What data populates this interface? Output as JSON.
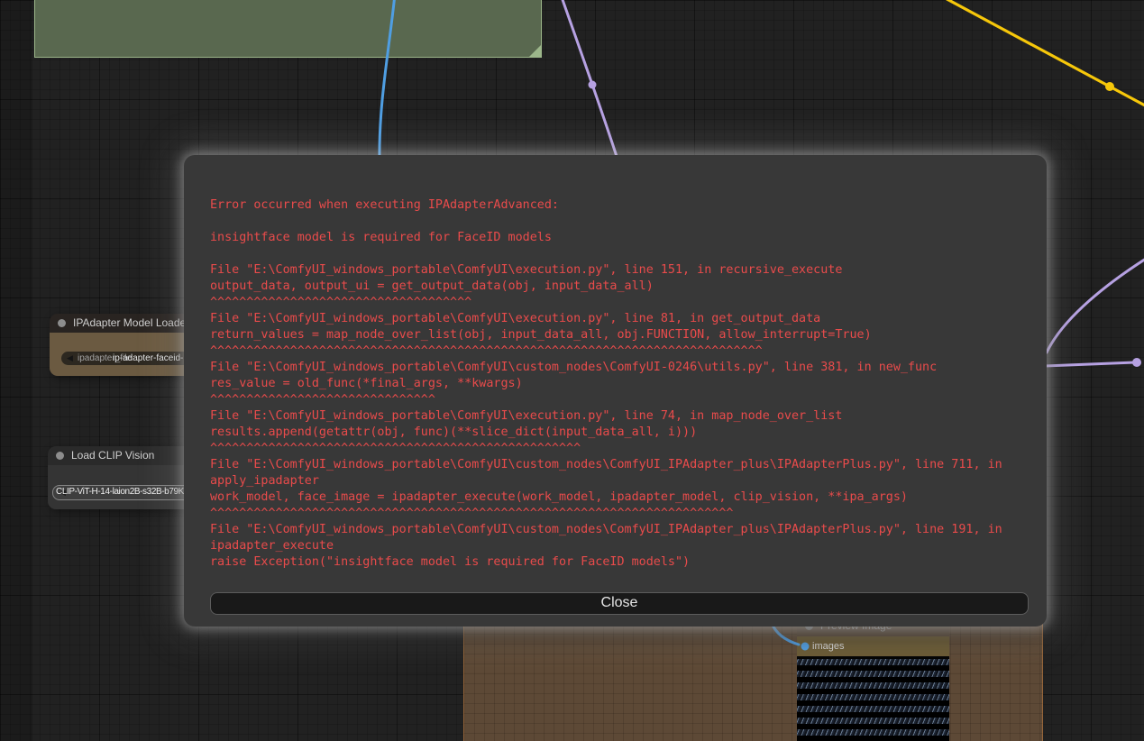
{
  "colors": {
    "link_blue": "#4f9ee2",
    "link_purple": "#b6a1e2",
    "link_yellow": "#f6c70a",
    "error_text": "#e94b4b"
  },
  "dialog": {
    "title_line": "Error occurred when executing IPAdapterAdvanced:",
    "message": "insightface model is required for FaceID models",
    "traceback": [
      "File \"E:\\ComfyUI_windows_portable\\ComfyUI\\execution.py\", line 151, in recursive_execute",
      "output_data, output_ui = get_output_data(obj, input_data_all)",
      "^^^^^^^^^^^^^^^^^^^^^^^^^^^^^^^^^^^^",
      "File \"E:\\ComfyUI_windows_portable\\ComfyUI\\execution.py\", line 81, in get_output_data",
      "return_values = map_node_over_list(obj, input_data_all, obj.FUNCTION, allow_interrupt=True)",
      "^^^^^^^^^^^^^^^^^^^^^^^^^^^^^^^^^^^^^^^^^^^^^^^^^^^^^^^^^^^^^^^^^^^^^^^^^^^^",
      "File \"E:\\ComfyUI_windows_portable\\ComfyUI\\custom_nodes\\ComfyUI-0246\\utils.py\", line 381, in new_func",
      "res_value = old_func(*final_args, **kwargs)",
      "^^^^^^^^^^^^^^^^^^^^^^^^^^^^^^^",
      "File \"E:\\ComfyUI_windows_portable\\ComfyUI\\execution.py\", line 74, in map_node_over_list",
      "results.append(getattr(obj, func)(**slice_dict(input_data_all, i)))",
      "^^^^^^^^^^^^^^^^^^^^^^^^^^^^^^^^^^^^^^^^^^^^^^^^^^^",
      "File \"E:\\ComfyUI_windows_portable\\ComfyUI\\custom_nodes\\ComfyUI_IPAdapter_plus\\IPAdapterPlus.py\", line 711, in apply_ipadapter",
      "work_model, face_image = ipadapter_execute(work_model, ipadapter_model, clip_vision, **ipa_args)",
      "^^^^^^^^^^^^^^^^^^^^^^^^^^^^^^^^^^^^^^^^^^^^^^^^^^^^^^^^^^^^^^^^^^^^^^^^",
      "File \"E:\\ComfyUI_windows_portable\\ComfyUI\\custom_nodes\\ComfyUI_IPAdapter_plus\\IPAdapterPlus.py\", line 191, in ipadapter_execute",
      "raise Exception(\"insightface model is required for FaceID models\")"
    ],
    "close_label": "Close"
  },
  "nodes": {
    "ipadapter_loader": {
      "title": "IPAdapter Model Loader",
      "widget_arrow": "◀",
      "widget_label": "ipadapter_file",
      "widget_value": "ip-adapter-faceid-"
    },
    "clip_vision": {
      "title": "Load CLIP Vision",
      "widget_arrow": "◀",
      "widget_value": "CLIP-ViT-H-14-laion2B-s32B-b79K"
    },
    "preview_image": {
      "title": "Preview Image",
      "input_label": "images"
    }
  }
}
